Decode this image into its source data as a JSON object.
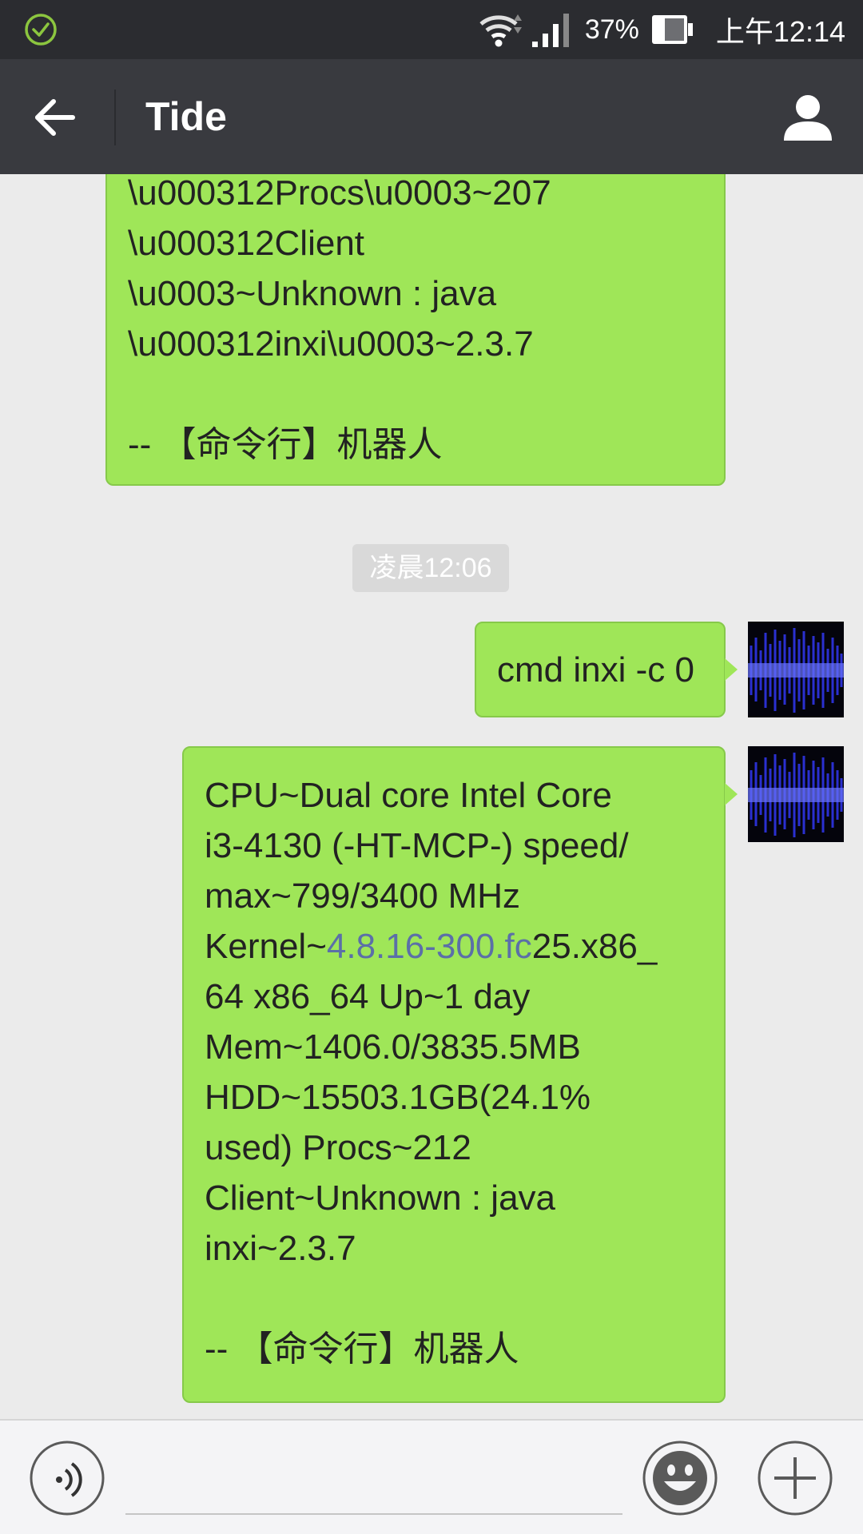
{
  "status_bar": {
    "battery_percent": "37%",
    "time": "上午12:14",
    "icons": [
      "check-circle-icon",
      "wifi-icon",
      "signal-icon",
      "battery-icon"
    ]
  },
  "header": {
    "title": "Tide",
    "back_icon": "arrow-left-icon",
    "profile_icon": "person-icon"
  },
  "messages": {
    "first": {
      "lines": [
        "\\u000312Procs\\u0003~207",
        "\\u000312Client",
        "\\u0003~Unknown : java",
        "\\u000312inxi\\u0003~2.3.7",
        "-- 【命令行】机器人"
      ]
    },
    "timestamp": "凌晨12:06",
    "command": {
      "text": "cmd inxi -c 0"
    },
    "reply": {
      "line1": "CPU~Dual core Intel Core",
      "line2": "i3-4130 (-HT-MCP-) speed/",
      "line3": "max~799/3400 MHz",
      "line4_prefix": "Kernel~",
      "line4_link": "4.8.16-300.fc",
      "line4_suffix": "25.x86_",
      "line5": "64 x86_64 Up~1 day",
      "line6": "Mem~1406.0/3835.5MB",
      "line7": "HDD~15503.1GB(24.1%",
      "line8": "used) Procs~212",
      "line9": "Client~Unknown : java",
      "line10": "inxi~2.3.7",
      "signature": "-- 【命令行】机器人"
    }
  },
  "input_bar": {
    "voice_icon": "voice-icon",
    "emoji_icon": "emoji-icon",
    "plus_icon": "plus-icon",
    "placeholder": ""
  },
  "colors": {
    "bubble": "#9fe658",
    "header": "#393a3f",
    "status_bar": "#2b2c30",
    "chat_background": "#ebebeb",
    "link": "#5b6fa8"
  }
}
